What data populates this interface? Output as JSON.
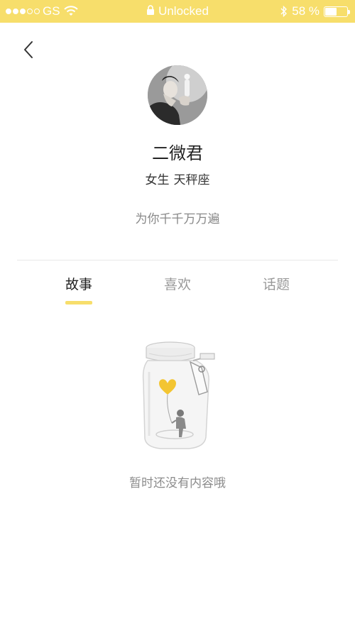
{
  "status_bar": {
    "carrier": "GS",
    "center_text": "Unlocked",
    "battery": "58 %",
    "battery_level": 0.58
  },
  "profile": {
    "name": "二微君",
    "gender": "女生",
    "sign": "天秤座",
    "bio": "为你千千万万遍"
  },
  "tabs": [
    {
      "label": "故事",
      "active": true
    },
    {
      "label": "喜欢",
      "active": false
    },
    {
      "label": "话题",
      "active": false
    }
  ],
  "empty_state": {
    "message": "暂时还没有内容哦"
  },
  "colors": {
    "accent": "#f7de6b",
    "heart": "#f3c532"
  },
  "icons": [
    "back-arrow-icon",
    "wifi-icon",
    "lock-icon",
    "bluetooth-icon",
    "battery-icon",
    "empty-jar-illustration"
  ]
}
